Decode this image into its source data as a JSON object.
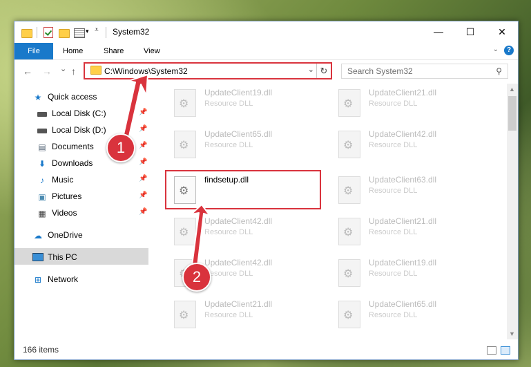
{
  "window": {
    "title": "System32"
  },
  "window_controls": {
    "minimize": "—",
    "maximize": "☐",
    "close": "✕"
  },
  "ribbon": {
    "tabs": [
      "File",
      "Home",
      "Share",
      "View"
    ]
  },
  "navigation": {
    "back": "←",
    "forward": "→",
    "recent": "⌄",
    "up": "↑"
  },
  "address": {
    "path": "C:\\Windows\\System32",
    "dropdown": "⌄",
    "refresh": "↻"
  },
  "search": {
    "placeholder": "Search System32"
  },
  "sidebar": {
    "items": [
      {
        "label": "Quick access",
        "icon": "star-icon",
        "pinned": false
      },
      {
        "label": "Local Disk (C:)",
        "icon": "drive-icon",
        "pinned": true
      },
      {
        "label": "Local Disk (D:)",
        "icon": "drive-icon",
        "pinned": true
      },
      {
        "label": "Documents",
        "icon": "documents-icon",
        "pinned": true
      },
      {
        "label": "Downloads",
        "icon": "download-icon",
        "pinned": true
      },
      {
        "label": "Music",
        "icon": "music-icon",
        "pinned": true
      },
      {
        "label": "Pictures",
        "icon": "pictures-icon",
        "pinned": true
      },
      {
        "label": "Videos",
        "icon": "videos-icon",
        "pinned": true
      },
      {
        "label": "OneDrive",
        "icon": "cloud-icon",
        "pinned": false
      },
      {
        "label": "This PC",
        "icon": "computer-icon",
        "pinned": false,
        "selected": true
      },
      {
        "label": "Network",
        "icon": "network-icon",
        "pinned": false
      }
    ]
  },
  "files": {
    "left": [
      {
        "name": "UpdateClient19.dll",
        "type": "Resource DLL"
      },
      {
        "name": "UpdateClient65.dll",
        "type": "Resource DLL"
      },
      {
        "name": "findsetup.dll",
        "type": ""
      },
      {
        "name": "UpdateClient42.dll",
        "type": "Resource DLL"
      },
      {
        "name": "UpdateClient42.dll",
        "type": "Resource DLL"
      },
      {
        "name": "UpdateClient21.dll",
        "type": "Resource DLL"
      }
    ],
    "right": [
      {
        "name": "UpdateClient21.dll",
        "type": "Resource DLL"
      },
      {
        "name": "UpdateClient42.dll",
        "type": "Resource DLL"
      },
      {
        "name": "UpdateClient63.dll",
        "type": "Resource DLL"
      },
      {
        "name": "UpdateClient21.dll",
        "type": "Resource DLL"
      },
      {
        "name": "UpdateClient19.dll",
        "type": "Resource DLL"
      },
      {
        "name": "UpdateClient65.dll",
        "type": "Resource DLL"
      }
    ]
  },
  "status": {
    "items": "166 items"
  },
  "callouts": [
    "1",
    "2"
  ],
  "colors": {
    "accent": "#1979ca",
    "highlight": "#d9333d"
  }
}
